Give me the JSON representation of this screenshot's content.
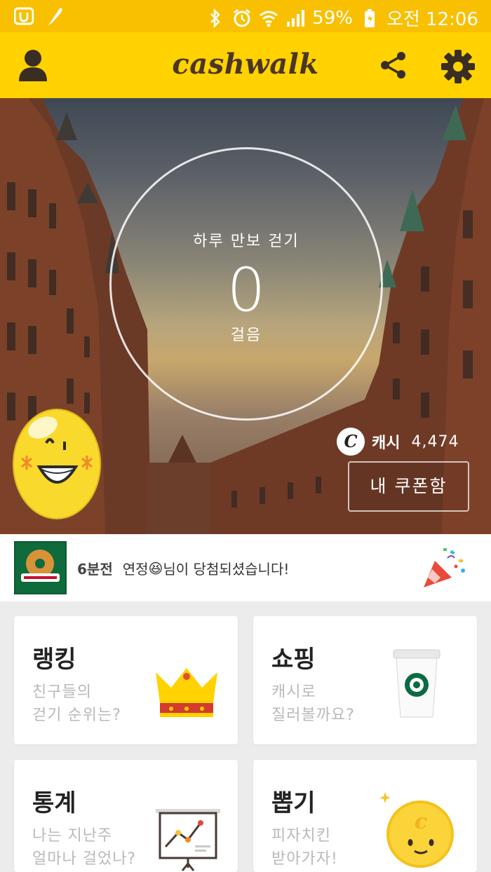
{
  "status_bar": {
    "battery_text": "59%",
    "time_text": "오전 12:06",
    "icons": [
      "app-u-icon",
      "feather-icon",
      "bluetooth-icon",
      "alarm-icon",
      "wifi-icon",
      "signal-icon",
      "battery-charging-icon"
    ]
  },
  "app_bar": {
    "logo": "cashwalk",
    "icons": [
      "profile-icon",
      "share-icon",
      "settings-gear-icon"
    ],
    "colors": {
      "brand_yellow": "#ffd200",
      "logo_brown": "#4a3626"
    }
  },
  "steps": {
    "title": "하루 만보 걷기",
    "count": "0",
    "unit": "걸음"
  },
  "cash": {
    "icon_letter": "C",
    "label": "캐시",
    "amount": "4,474",
    "coupon_button": "내 쿠폰함"
  },
  "notice": {
    "time": "6분전",
    "message_prefix": "연정",
    "emoji": "😆",
    "message_suffix": "님이 당첨되셨습니다!",
    "thumb_icon": "krispy-kreme-donut-icon",
    "party_icon": "party-popper-icon"
  },
  "cards": {
    "ranking": {
      "title": "랭킹",
      "subtitle": "친구들의\n걷기 순위는?",
      "icon": "crown-icon"
    },
    "shopping": {
      "title": "쇼핑",
      "subtitle": "캐시로\n질러볼까요?",
      "icon": "coffee-cup-icon"
    },
    "stats": {
      "title": "통계",
      "subtitle": "나는 지난주\n얼마나 걸었나?",
      "icon": "chart-board-icon"
    },
    "draw": {
      "title": "뽑기",
      "subtitle": "피자치킨\n받아가자!",
      "icon": "coin-character-icon"
    }
  }
}
